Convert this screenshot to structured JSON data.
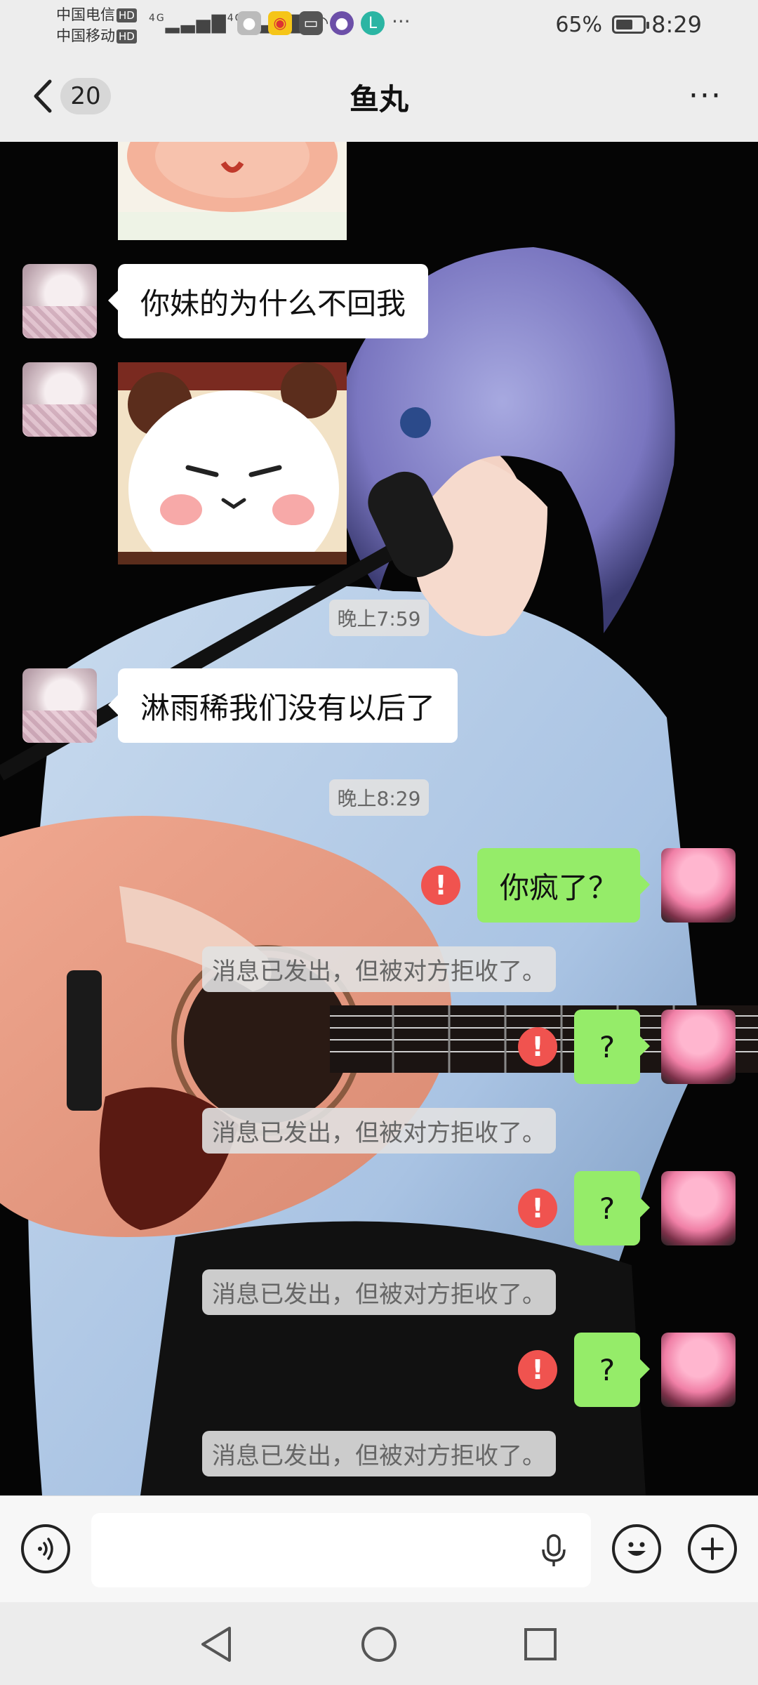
{
  "status_bar": {
    "carrier_1": "中国电信",
    "carrier_2": "中国移动",
    "hd_badge": "HD",
    "network": "4G",
    "battery_text": "65%",
    "battery_level": 0.65,
    "time": "8:29",
    "notification_icons": [
      "wechat-icon",
      "weibo-icon",
      "bag-icon",
      "game-icon",
      "app-icon"
    ],
    "more": "···"
  },
  "nav": {
    "unread_count": "20",
    "title": "鱼丸",
    "more": "···"
  },
  "chat": {
    "messages": [
      {
        "side": "left",
        "type": "sticker",
        "desc": "sticker-bottom"
      },
      {
        "side": "left",
        "type": "text",
        "text": "你妹的为什么不回我"
      },
      {
        "side": "left",
        "type": "sticker",
        "desc": "panda-sticker"
      },
      {
        "type": "time",
        "text": "晚上7:59"
      },
      {
        "side": "left",
        "type": "text",
        "text": "淋雨稀我们没有以后了"
      },
      {
        "type": "time",
        "text": "晚上8:29"
      },
      {
        "side": "right",
        "type": "text",
        "text": "你疯了？",
        "failed": true
      },
      {
        "type": "system",
        "text": "消息已发出，但被对方拒收了。"
      },
      {
        "side": "right",
        "type": "text",
        "text": "?",
        "failed": true
      },
      {
        "type": "system",
        "text": "消息已发出，但被对方拒收了。"
      },
      {
        "side": "right",
        "type": "text",
        "text": "?",
        "failed": true
      },
      {
        "type": "system",
        "text": "消息已发出，但被对方拒收了。"
      },
      {
        "side": "right",
        "type": "text",
        "text": "?",
        "failed": true
      },
      {
        "type": "system",
        "text": "消息已发出，但被对方拒收了。"
      }
    ],
    "error_mark": "!"
  },
  "input": {
    "placeholder": ""
  },
  "colors": {
    "sent_bubble": "#95ec69",
    "received_bubble": "#ffffff",
    "error": "#f0534f",
    "chrome": "#ededed"
  }
}
